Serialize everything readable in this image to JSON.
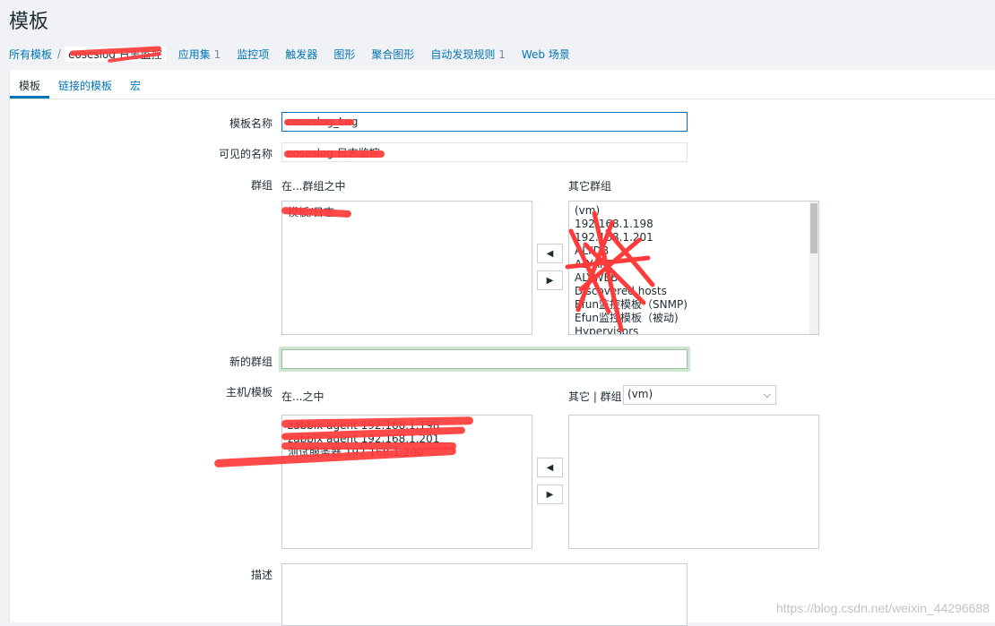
{
  "page": {
    "title": "模板"
  },
  "nav": {
    "all_templates": "所有模板",
    "separator": "/",
    "current_template": "eoseslog 日志监控",
    "applications": "应用集",
    "applications_count": "1",
    "items": "监控项",
    "triggers": "触发器",
    "graphs": "图形",
    "screens": "聚合图形",
    "discovery": "自动发现规则",
    "discovery_count": "1",
    "web": "Web 场景"
  },
  "tabs": [
    "模板",
    "链接的模板",
    "宏"
  ],
  "form": {
    "template_name_label": "模板名称",
    "template_name_value": "eoseslog_Log",
    "visible_name_label": "可见的名称",
    "visible_name_value": "eoseslog 日志监控",
    "groups_label": "群组",
    "in_groups_label": "在...群组之中",
    "in_groups": [
      "模板/日志"
    ],
    "other_groups_label": "其它群组",
    "other_groups": [
      "(vm)",
      "192.168.1.198",
      "192.168.1.201",
      "ALYDB",
      "ALYAPP",
      "ALYWEB",
      "Discovered hosts",
      "Efun监控模板（SNMP)",
      "Efun监控模板（被动)",
      "Hypervisors"
    ],
    "new_group_label": "新的群组",
    "new_group_value": "",
    "hosts_label": "主机/模板",
    "in_hosts_label": "在...之中",
    "in_hosts": [
      "zabbix agent 192.168.1.198",
      "zabbix agent 192.168.1.201",
      "测试服务器 192.168.1.200"
    ],
    "other_hosts_label": "其它 | 群组",
    "other_hosts_select": "(vm)",
    "other_hosts": [],
    "description_label": "描述",
    "description_value": ""
  },
  "buttons": {
    "move_left": "◀",
    "move_right": "▶"
  },
  "watermark": "https://blog.csdn.net/weixin_44296688",
  "colors": {
    "link": "#0275b8",
    "accent": "#0275b8",
    "redaction": "#ff3b3b"
  }
}
